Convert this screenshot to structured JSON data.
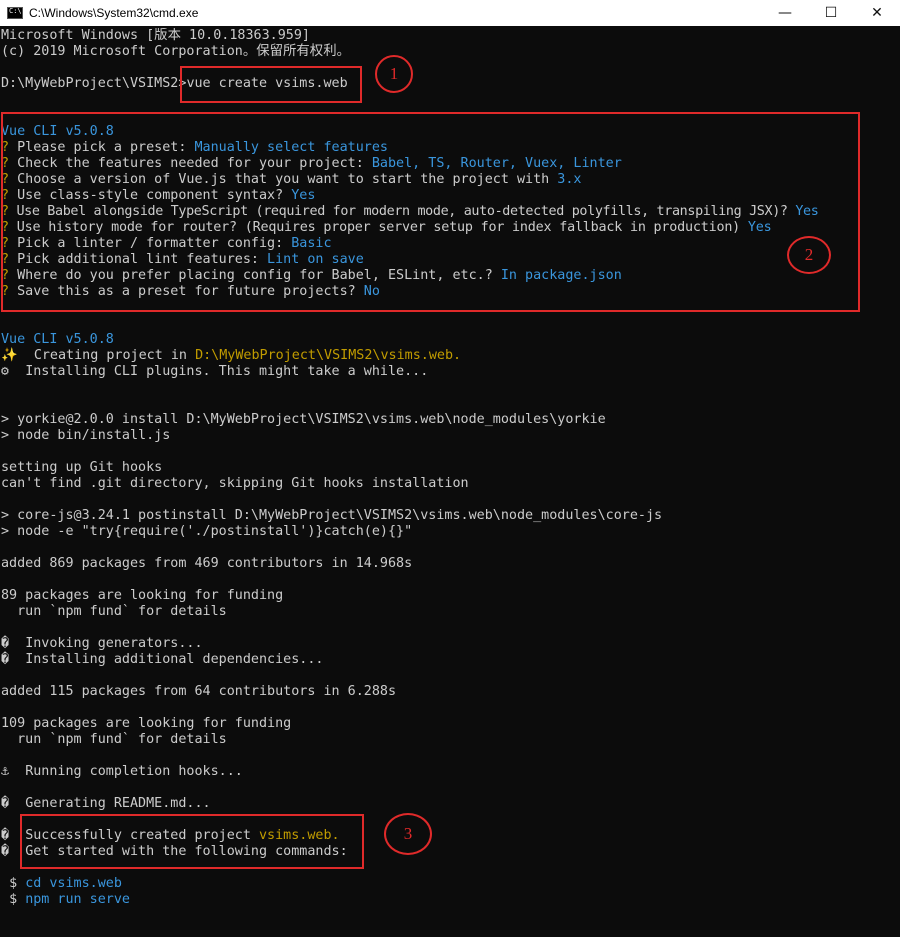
{
  "window": {
    "title": "C:\\Windows\\System32\\cmd.exe",
    "icon_text": "C:\\",
    "minimize": "—",
    "maximize": "☐",
    "close": "✕"
  },
  "console": {
    "header": {
      "l1": "Microsoft Windows [版本 10.0.18363.959]",
      "l2": "(c) 2019 Microsoft Corporation。保留所有权利。"
    },
    "command": {
      "prompt": "D:\\MyWebProject\\VSIMS2>",
      "cmd": "vue create vsims.web"
    },
    "cli1": "Vue CLI v5.0.8",
    "questions": [
      {
        "q": "Please pick a preset:",
        "a": "Manually select features"
      },
      {
        "q": "Check the features needed for your project:",
        "a": "Babel, TS, Router, Vuex, Linter"
      },
      {
        "q": "Choose a version of Vue.js that you want to start the project with",
        "a": "3.x"
      },
      {
        "q": "Use class-style component syntax?",
        "a": "Yes"
      },
      {
        "q": "Use Babel alongside TypeScript (required for modern mode, auto-detected polyfills, transpiling JSX)?",
        "a": "Yes"
      },
      {
        "q": "Use history mode for router? (Requires proper server setup for index fallback in production)",
        "a": "Yes"
      },
      {
        "q": "Pick a linter / formatter config:",
        "a": "Basic"
      },
      {
        "q": "Pick additional lint features:",
        "a": "Lint on save"
      },
      {
        "q": "Where do you prefer placing config for Babel, ESLint, etc.?",
        "a": "In package.json"
      },
      {
        "q": "Save this as a preset for future projects?",
        "a": "No"
      }
    ],
    "q_mark": "?",
    "cli2": "Vue CLI v5.0.8",
    "creating": {
      "glyph": "✨",
      "text": "Creating project in",
      "path": "D:\\MyWebProject\\VSIMS2\\vsims.web."
    },
    "installing": {
      "glyph": "⚙",
      "text": "Installing CLI plugins. This might take a while..."
    },
    "yorkie": "> yorkie@2.0.0 install D:\\MyWebProject\\VSIMS2\\vsims.web\\node_modules\\yorkie",
    "node_install": "> node bin/install.js",
    "git1": "setting up Git hooks",
    "git2": "can't find .git directory, skipping Git hooks installation",
    "corejs": "> core-js@3.24.1 postinstall D:\\MyWebProject\\VSIMS2\\vsims.web\\node_modules\\core-js",
    "node_post": "> node -e \"try{require('./postinstall')}catch(e){}\"",
    "added1": "added 869 packages from 469 contributors in 14.968s",
    "fund1a": "89 packages are looking for funding",
    "fund1b": "  run `npm fund` for details",
    "unknown_glyph": "�",
    "invoking": "Invoking generators...",
    "installing_deps": "Installing additional dependencies...",
    "added2": "added 115 packages from 64 contributors in 6.288s",
    "fund2a": "109 packages are looking for funding",
    "fund2b": "  run `npm fund` for details",
    "hooks_glyph": "⚓",
    "hooks": "Running completion hooks...",
    "readme": "Generating README.md...",
    "success": {
      "text": "Successfully created project",
      "name": "vsims.web."
    },
    "get_started": "Get started with the following commands:",
    "dollar": "$",
    "cmd_cd": "cd vsims.web",
    "cmd_serve": "npm run serve"
  },
  "annotations": {
    "n1": "1",
    "n2": "2",
    "n3": "3"
  },
  "colors": {
    "highlight_blue": "#3a96dd",
    "highlight_yellow": "#c19c00",
    "annotation_red": "#e02a2a"
  }
}
